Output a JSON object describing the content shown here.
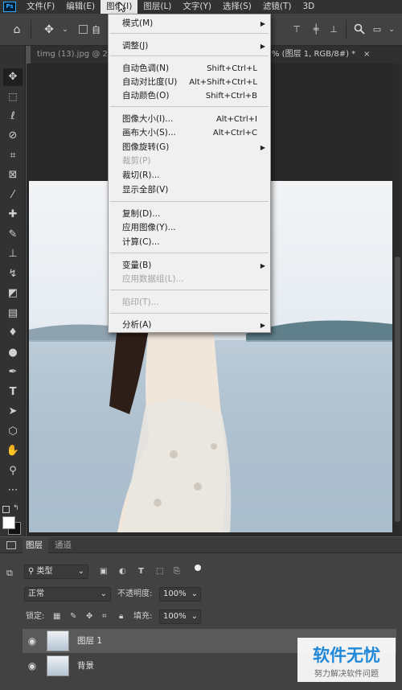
{
  "menubar": {
    "items": [
      "文件(F)",
      "编辑(E)",
      "图像(I)",
      "图层(L)",
      "文字(Y)",
      "选择(S)",
      "滤镜(T)",
      "3D"
    ],
    "active_index": 2,
    "logo": "Ps"
  },
  "options_bar": {
    "home_icon": "home-icon",
    "move_icon": "move-icon",
    "auto_select_label": "自"
  },
  "doc_tabs": {
    "left_tab": "timg (13).jpg @ 2",
    "right_tab": "% (图层 1, RGB/8#) *",
    "close": "×"
  },
  "image_menu": {
    "items": [
      {
        "label": "模式(M)",
        "submenu": true
      },
      {
        "label": "调整(J)",
        "submenu": true
      },
      {
        "label": "自动色调(N)",
        "shortcut": "Shift+Ctrl+L"
      },
      {
        "label": "自动对比度(U)",
        "shortcut": "Alt+Shift+Ctrl+L"
      },
      {
        "label": "自动颜色(O)",
        "shortcut": "Shift+Ctrl+B"
      },
      {
        "label": "图像大小(I)...",
        "shortcut": "Alt+Ctrl+I"
      },
      {
        "label": "画布大小(S)...",
        "shortcut": "Alt+Ctrl+C"
      },
      {
        "label": "图像旋转(G)",
        "submenu": true
      },
      {
        "label": "裁剪(P)",
        "disabled": true
      },
      {
        "label": "裁切(R)..."
      },
      {
        "label": "显示全部(V)"
      },
      {
        "label": "复制(D)..."
      },
      {
        "label": "应用图像(Y)..."
      },
      {
        "label": "计算(C)..."
      },
      {
        "label": "变量(B)",
        "submenu": true
      },
      {
        "label": "应用数据组(L)...",
        "disabled": true
      },
      {
        "label": "陷印(T)...",
        "disabled": true
      },
      {
        "label": "分析(A)",
        "submenu": true
      }
    ]
  },
  "layers_panel": {
    "tabs": [
      "图层",
      "通道"
    ],
    "filter_kind": "类型",
    "blend_mode": "正常",
    "opacity_label": "不透明度:",
    "opacity_value": "100%",
    "lock_label": "锁定:",
    "fill_label": "填充:",
    "fill_value": "100%",
    "layers": [
      {
        "name": "图层 1",
        "selected": true
      },
      {
        "name": "背景",
        "selected": false
      }
    ]
  },
  "watermark": {
    "title": "软件无忧",
    "subtitle": "努力解决软件问题"
  },
  "colors": {
    "menubar_bg": "#323232",
    "menu_bg": "#f0f0f0",
    "panel_bg": "#424242",
    "accent": "#31a8ff"
  }
}
